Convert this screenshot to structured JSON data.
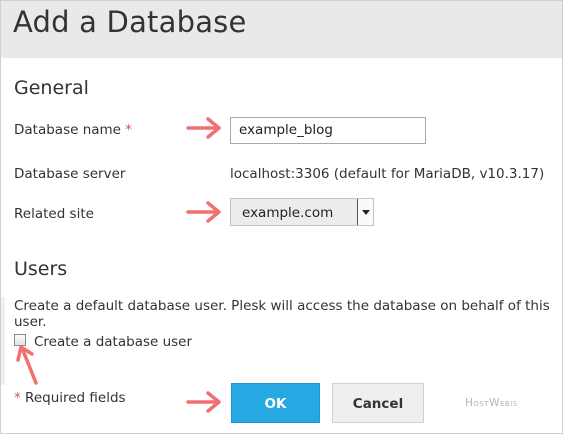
{
  "page": {
    "title": "Add a Database"
  },
  "general": {
    "heading": "General",
    "db_name": {
      "label": "Database name",
      "required_mark": "*",
      "value": "example_blog"
    },
    "db_server": {
      "label": "Database server",
      "value": "localhost:3306 (default for MariaDB, v10.3.17)"
    },
    "related_site": {
      "label": "Related site",
      "selected": "example.com"
    }
  },
  "users": {
    "heading": "Users",
    "description": "Create a default database user. Plesk will access the database on behalf of this user.",
    "create_user": {
      "label": "Create a database user",
      "checked": false
    }
  },
  "footer": {
    "required_mark": "*",
    "required_text": "Required fields",
    "ok_label": "OK",
    "cancel_label": "Cancel"
  },
  "watermark": "HostWebis",
  "colors": {
    "arrow": "#f07070",
    "ok_button": "#28a8e3",
    "header_bg": "#e9e9e9",
    "required": "#d9534f"
  }
}
